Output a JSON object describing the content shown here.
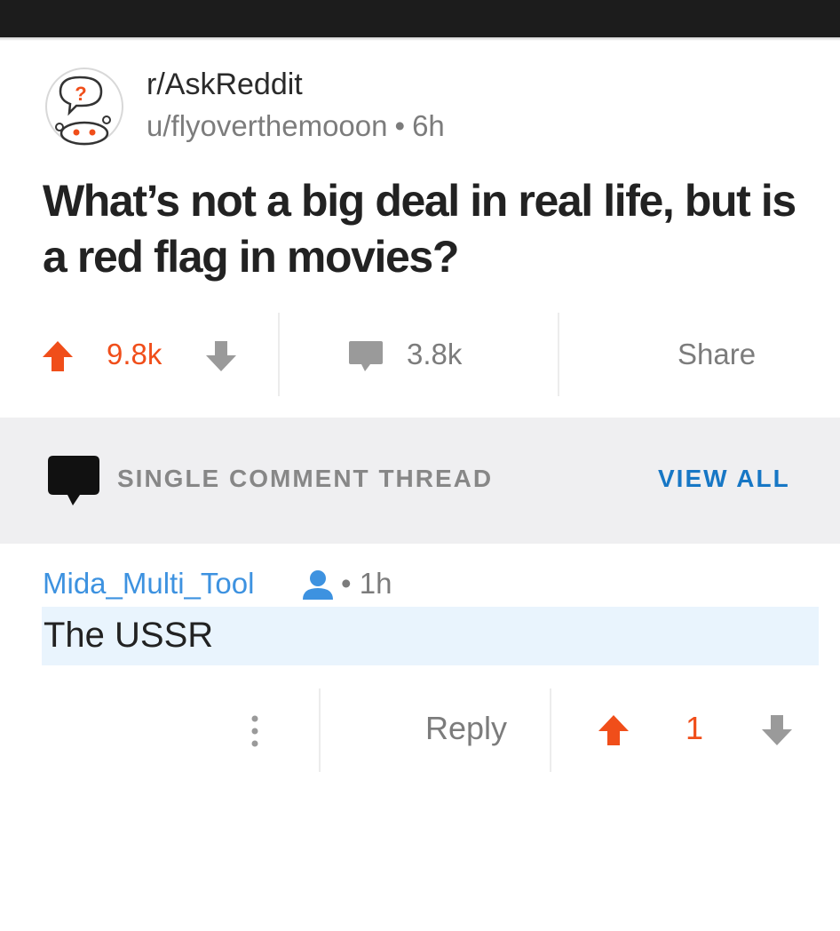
{
  "subreddit": {
    "name": "r/AskReddit",
    "icon": "askreddit-snoo-icon"
  },
  "post": {
    "author": "u/flyoverthemooon",
    "separator": "•",
    "age": "6h",
    "title": "What’s not a big deal in real life, but is a red flag in movies?",
    "score": "9.8k",
    "comments": "3.8k",
    "share_label": "Share"
  },
  "thread_bar": {
    "label": "SINGLE COMMENT THREAD",
    "view_all_label": "VIEW ALL"
  },
  "comment": {
    "author": "Mida_Multi_Tool",
    "separator": "•",
    "age": "1h",
    "body": "The USSR",
    "reply_label": "Reply",
    "score": "1"
  },
  "colors": {
    "upvote": "#f04e1a",
    "link_blue": "#1777c5",
    "author_blue": "#3d92e0",
    "muted": "#7c7c7c",
    "highlight": "#e9f4fd",
    "thread_bar_bg": "#efeff1"
  }
}
